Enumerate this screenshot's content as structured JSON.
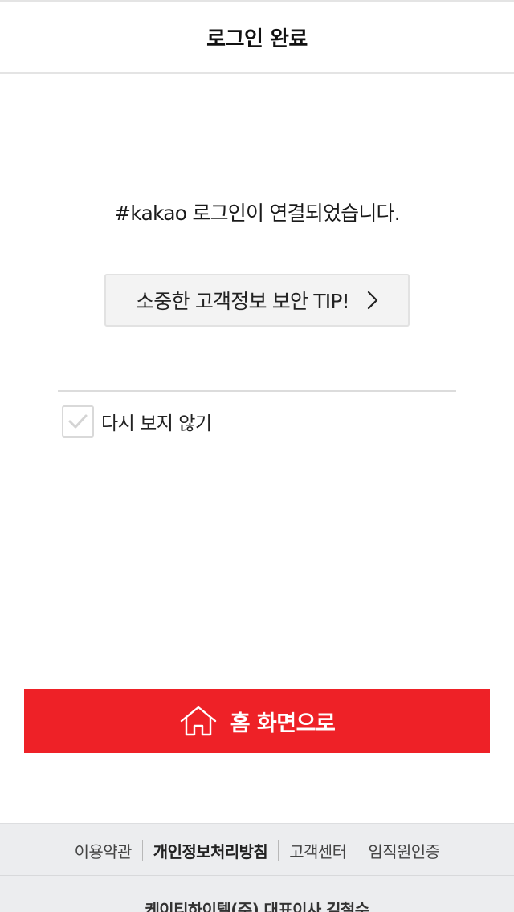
{
  "header": {
    "title": "로그인 완료"
  },
  "main": {
    "message": "#kakao 로그인이 연결되었습니다.",
    "tip_button": {
      "label": "소중한 고객정보 보안 TIP!",
      "icon": "chevron-right-icon"
    },
    "dont_show_again": {
      "label": "다시 보지 않기",
      "checked": false
    },
    "home_button": {
      "label": "홈 화면으로",
      "icon": "home-icon"
    }
  },
  "footer": {
    "links": [
      {
        "label": "이용약관"
      },
      {
        "label": "개인정보처리방침"
      },
      {
        "label": "고객센터"
      },
      {
        "label": "임직원인증"
      }
    ],
    "company": "케이티하이텔(주) 대표이사 김철수"
  },
  "colors": {
    "primary_red": "#ee2127",
    "tip_button_bg": "#f3f3f3",
    "footer_bg": "#ecedef"
  }
}
